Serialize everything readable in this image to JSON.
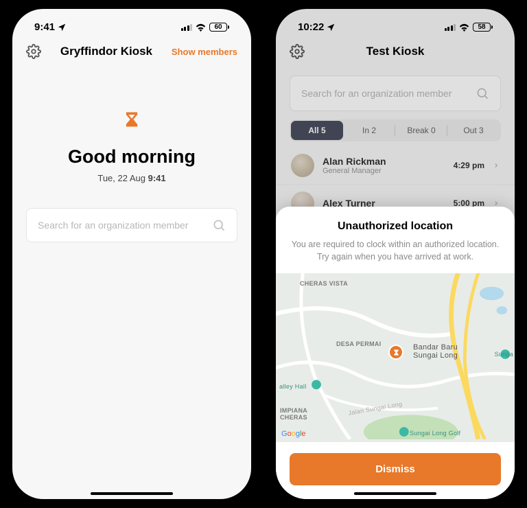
{
  "phone1": {
    "status": {
      "time": "9:41",
      "battery": "60"
    },
    "header": {
      "title": "Gryffindor Kiosk",
      "show_members": "Show members"
    },
    "welcome": {
      "greeting": "Good morning",
      "date_prefix": "Tue, 22 Aug ",
      "date_time": "9:41"
    },
    "search": {
      "placeholder": "Search for an organization member"
    }
  },
  "phone2": {
    "status": {
      "time": "10:22",
      "battery": "58"
    },
    "header": {
      "title": "Test Kiosk"
    },
    "search": {
      "placeholder": "Search for an organization member"
    },
    "segments": {
      "all": "All 5",
      "in": "In 2",
      "break": "Break 0",
      "out": "Out 3"
    },
    "members": [
      {
        "name": "Alan Rickman",
        "role": "General Manager",
        "time": "4:29 pm"
      },
      {
        "name": "Alex Turner",
        "role": "",
        "time": "5:00 pm"
      }
    ],
    "sheet": {
      "title": "Unauthorized location",
      "line1": "You are required to clock within an authorized location.",
      "line2": "Try again when you have arrived at work.",
      "dismiss": "Dismiss"
    },
    "map": {
      "labels": {
        "cheras_vista": "CHERAS VISTA",
        "desa_permai": "DESA PERMAI",
        "bandar_baru": "Bandar Baru\nSungai Long",
        "valley_hall": "alley Hall",
        "impiana": "IMPIANA\nCHERAS",
        "jalan": "Jalan Sungai Long",
        "golf": "Sungai Long Golf",
        "sunga": "Sunga"
      }
    }
  }
}
